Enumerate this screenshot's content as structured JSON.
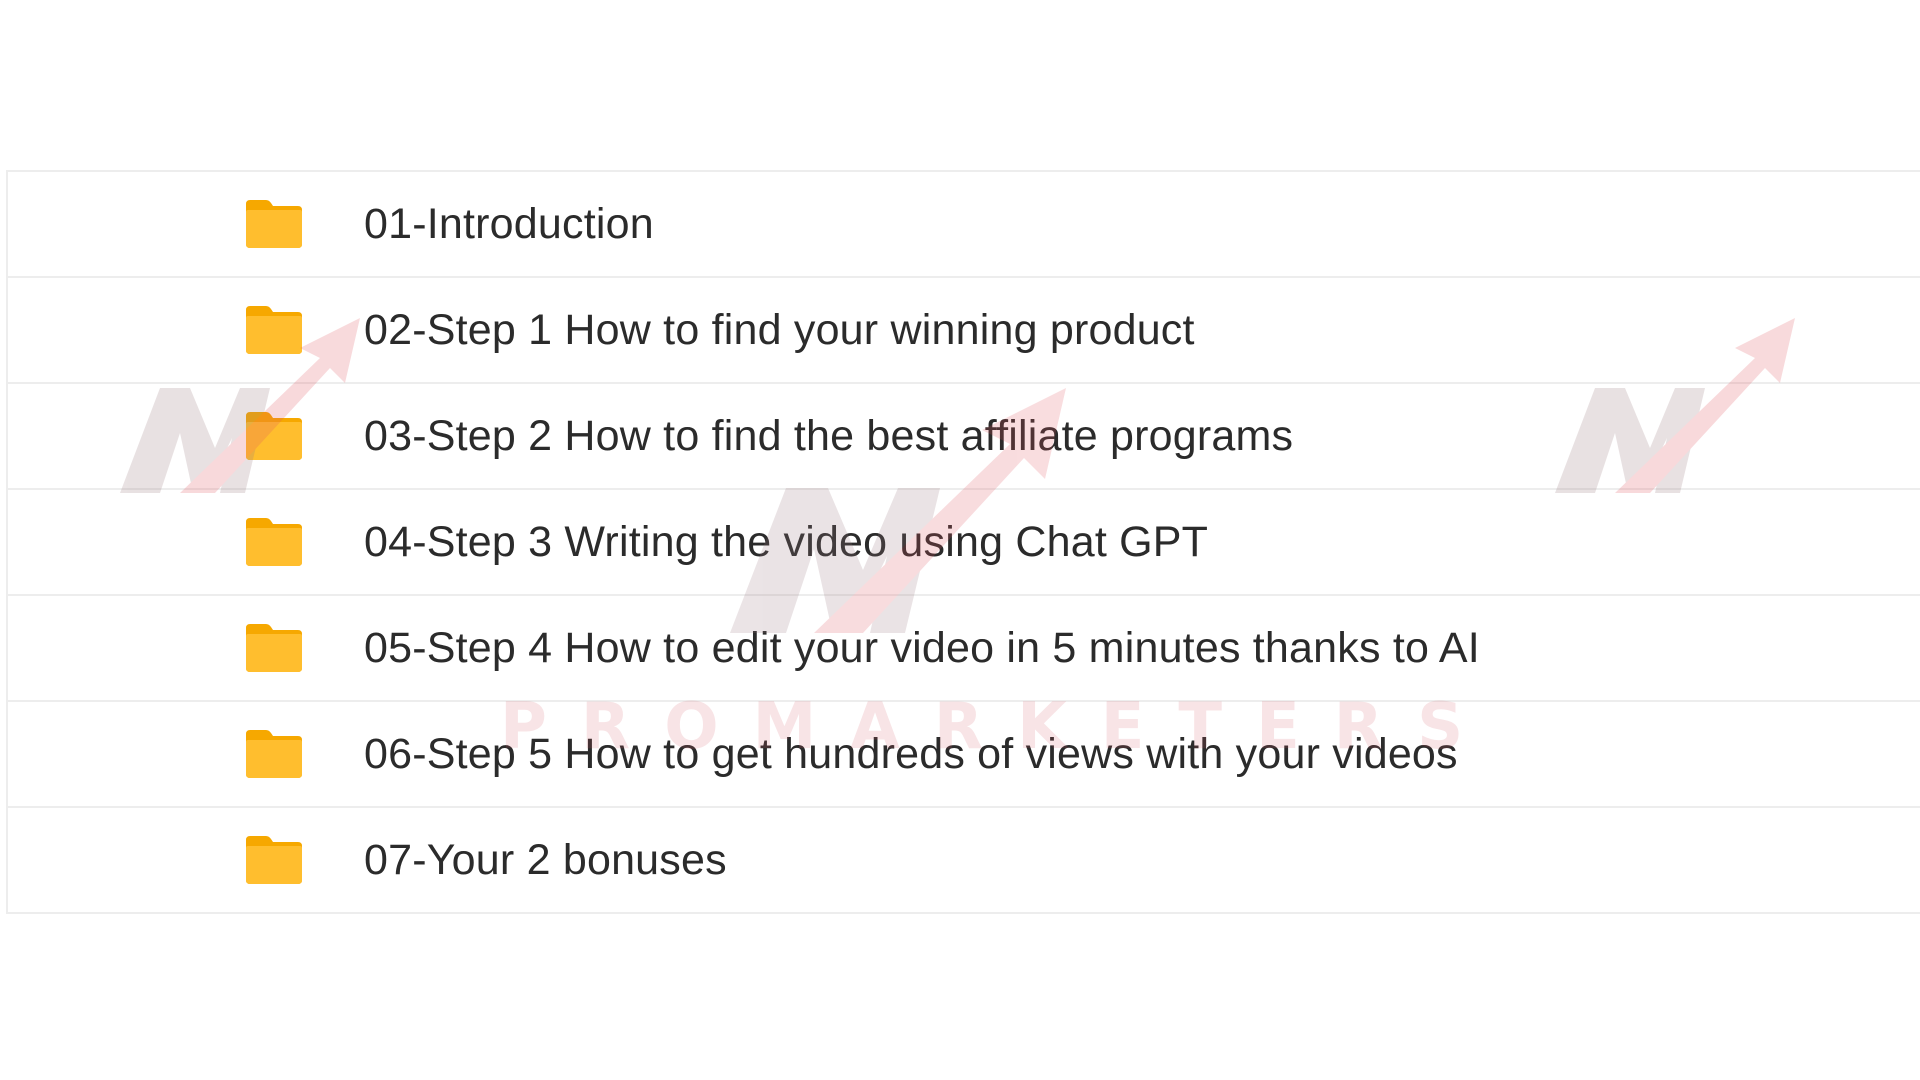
{
  "folders": [
    {
      "label": "01-Introduction",
      "icon": "folder-icon"
    },
    {
      "label": "02-Step 1 How to find your winning product",
      "icon": "folder-icon"
    },
    {
      "label": "03-Step 2 How to find the best affiliate programs",
      "icon": "folder-icon"
    },
    {
      "label": "04-Step 3 Writing the video using Chat GPT",
      "icon": "folder-icon"
    },
    {
      "label": "05-Step 4 How to edit your video in 5 minutes thanks to AI",
      "icon": "folder-icon"
    },
    {
      "label": "06-Step 5 How to get hundreds of views with your videos",
      "icon": "folder-icon"
    },
    {
      "label": "07-Your 2 bonuses",
      "icon": "folder-icon"
    }
  ],
  "watermark": {
    "text": "PROMARKETERS",
    "icon": "promarketers-logo-icon"
  },
  "colors": {
    "folder": "#FFB81C",
    "folder_tab": "#F6A800",
    "text": "#2B2B2B",
    "divider": "#EDEDED",
    "watermark": "#D25A64"
  }
}
